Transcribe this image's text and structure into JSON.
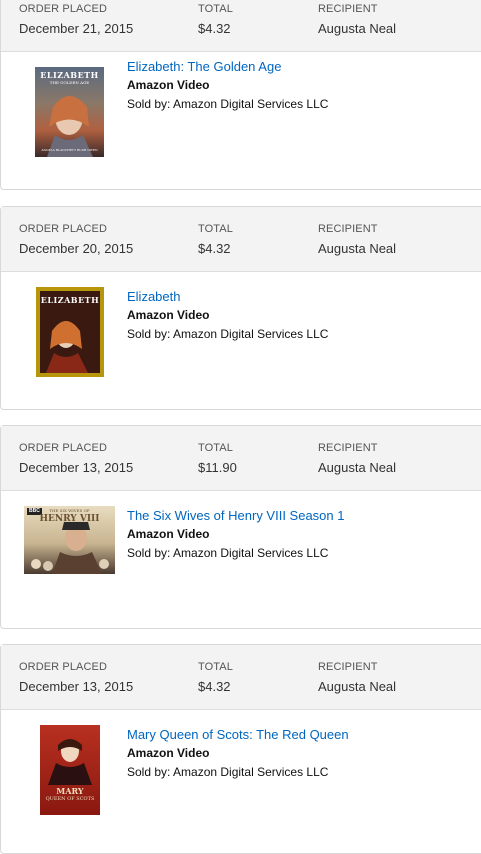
{
  "header_labels": {
    "order_placed": "ORDER PLACED",
    "total": "TOTAL",
    "recipient": "RECIPIENT"
  },
  "orders": [
    {
      "date": "December 21, 2015",
      "total": "$4.32",
      "recipient": "Augusta Neal",
      "item": {
        "title": "Elizabeth: The Golden Age",
        "format": "Amazon Video",
        "seller": "Sold by: Amazon Digital Services LLC",
        "poster_title": "ELIZABETH",
        "poster_subtitle": "THE GOLDEN AGE",
        "poster_credits": "ANGELA BLANCHETT  RUSH  OWEN"
      }
    },
    {
      "date": "December 20, 2015",
      "total": "$4.32",
      "recipient": "Augusta Neal",
      "item": {
        "title": "Elizabeth",
        "format": "Amazon Video",
        "seller": "Sold by: Amazon Digital Services LLC",
        "poster_title": "ELIZABETH"
      }
    },
    {
      "date": "December 13, 2015",
      "total": "$11.90",
      "recipient": "Augusta Neal",
      "item": {
        "title": "The Six Wives of Henry VIII Season 1",
        "format": "Amazon Video",
        "seller": "Sold by: Amazon Digital Services LLC",
        "poster_badge": "BBC",
        "poster_title": "HENRY VIII",
        "poster_subtitle": "THE SIX WIVES OF"
      }
    },
    {
      "date": "December 13, 2015",
      "total": "$4.32",
      "recipient": "Augusta Neal",
      "item": {
        "title": "Mary Queen of Scots: The Red Queen",
        "format": "Amazon Video",
        "seller": "Sold by: Amazon Digital Services LLC",
        "poster_title": "MARY",
        "poster_subtitle": "QUEEN OF SCOTS"
      }
    }
  ]
}
